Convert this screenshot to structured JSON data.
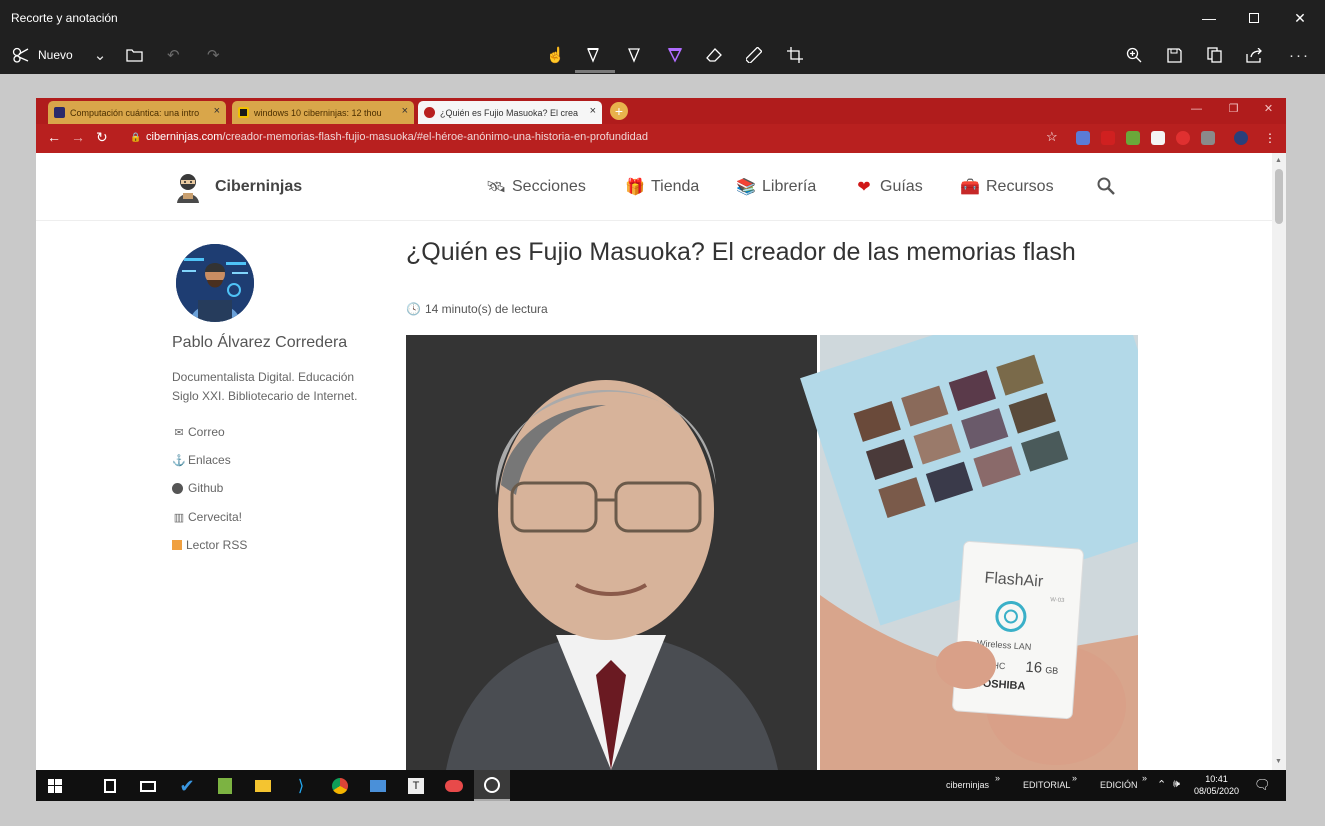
{
  "app": {
    "title": "Recorte y anotación",
    "new_label": "Nuevo"
  },
  "browser": {
    "tabs": [
      {
        "label": "Computación cuántica: una intro",
        "active": false
      },
      {
        "label": "windows 10 ciberninjas: 12 thou",
        "active": false
      },
      {
        "label": "¿Quién es Fujio Masuoka? El crea",
        "active": true
      }
    ],
    "url_domain": "ciberninjas.com",
    "url_path": "/creador-memorias-flash-fujio-masuoka/#el-héroe-anónimo-una-historia-en-profundidad"
  },
  "site": {
    "brand": "Ciberninjas",
    "menu": [
      "Secciones",
      "Tienda",
      "Librería",
      "Guías",
      "Recursos"
    ],
    "author": {
      "name": "Pablo Álvarez Corredera",
      "bio": "Documentalista Digital. Educación Siglo XXI. Bibliotecario de Internet.",
      "links": [
        "Correo",
        "Enlaces",
        "Github",
        "Cervecita!",
        "Lector RSS"
      ]
    },
    "post": {
      "title": "¿Quién es Fujio Masuoka? El creador de las memorias flash",
      "read_time": "14 minuto(s) de lectura",
      "card_brand": "FlashAir",
      "card_sub": "Wireless LAN",
      "card_size": "16",
      "card_unit": "GB",
      "card_maker": "TOSHIBA",
      "card_model": "W-03"
    }
  },
  "taskbar": {
    "tray_items": [
      "ciberninjas",
      "EDITORIAL",
      "EDICIÓN"
    ],
    "time": "10:41",
    "date": "08/05/2020"
  },
  "colors": {
    "browser_red": "#b8201f",
    "app_dark": "#202020"
  }
}
